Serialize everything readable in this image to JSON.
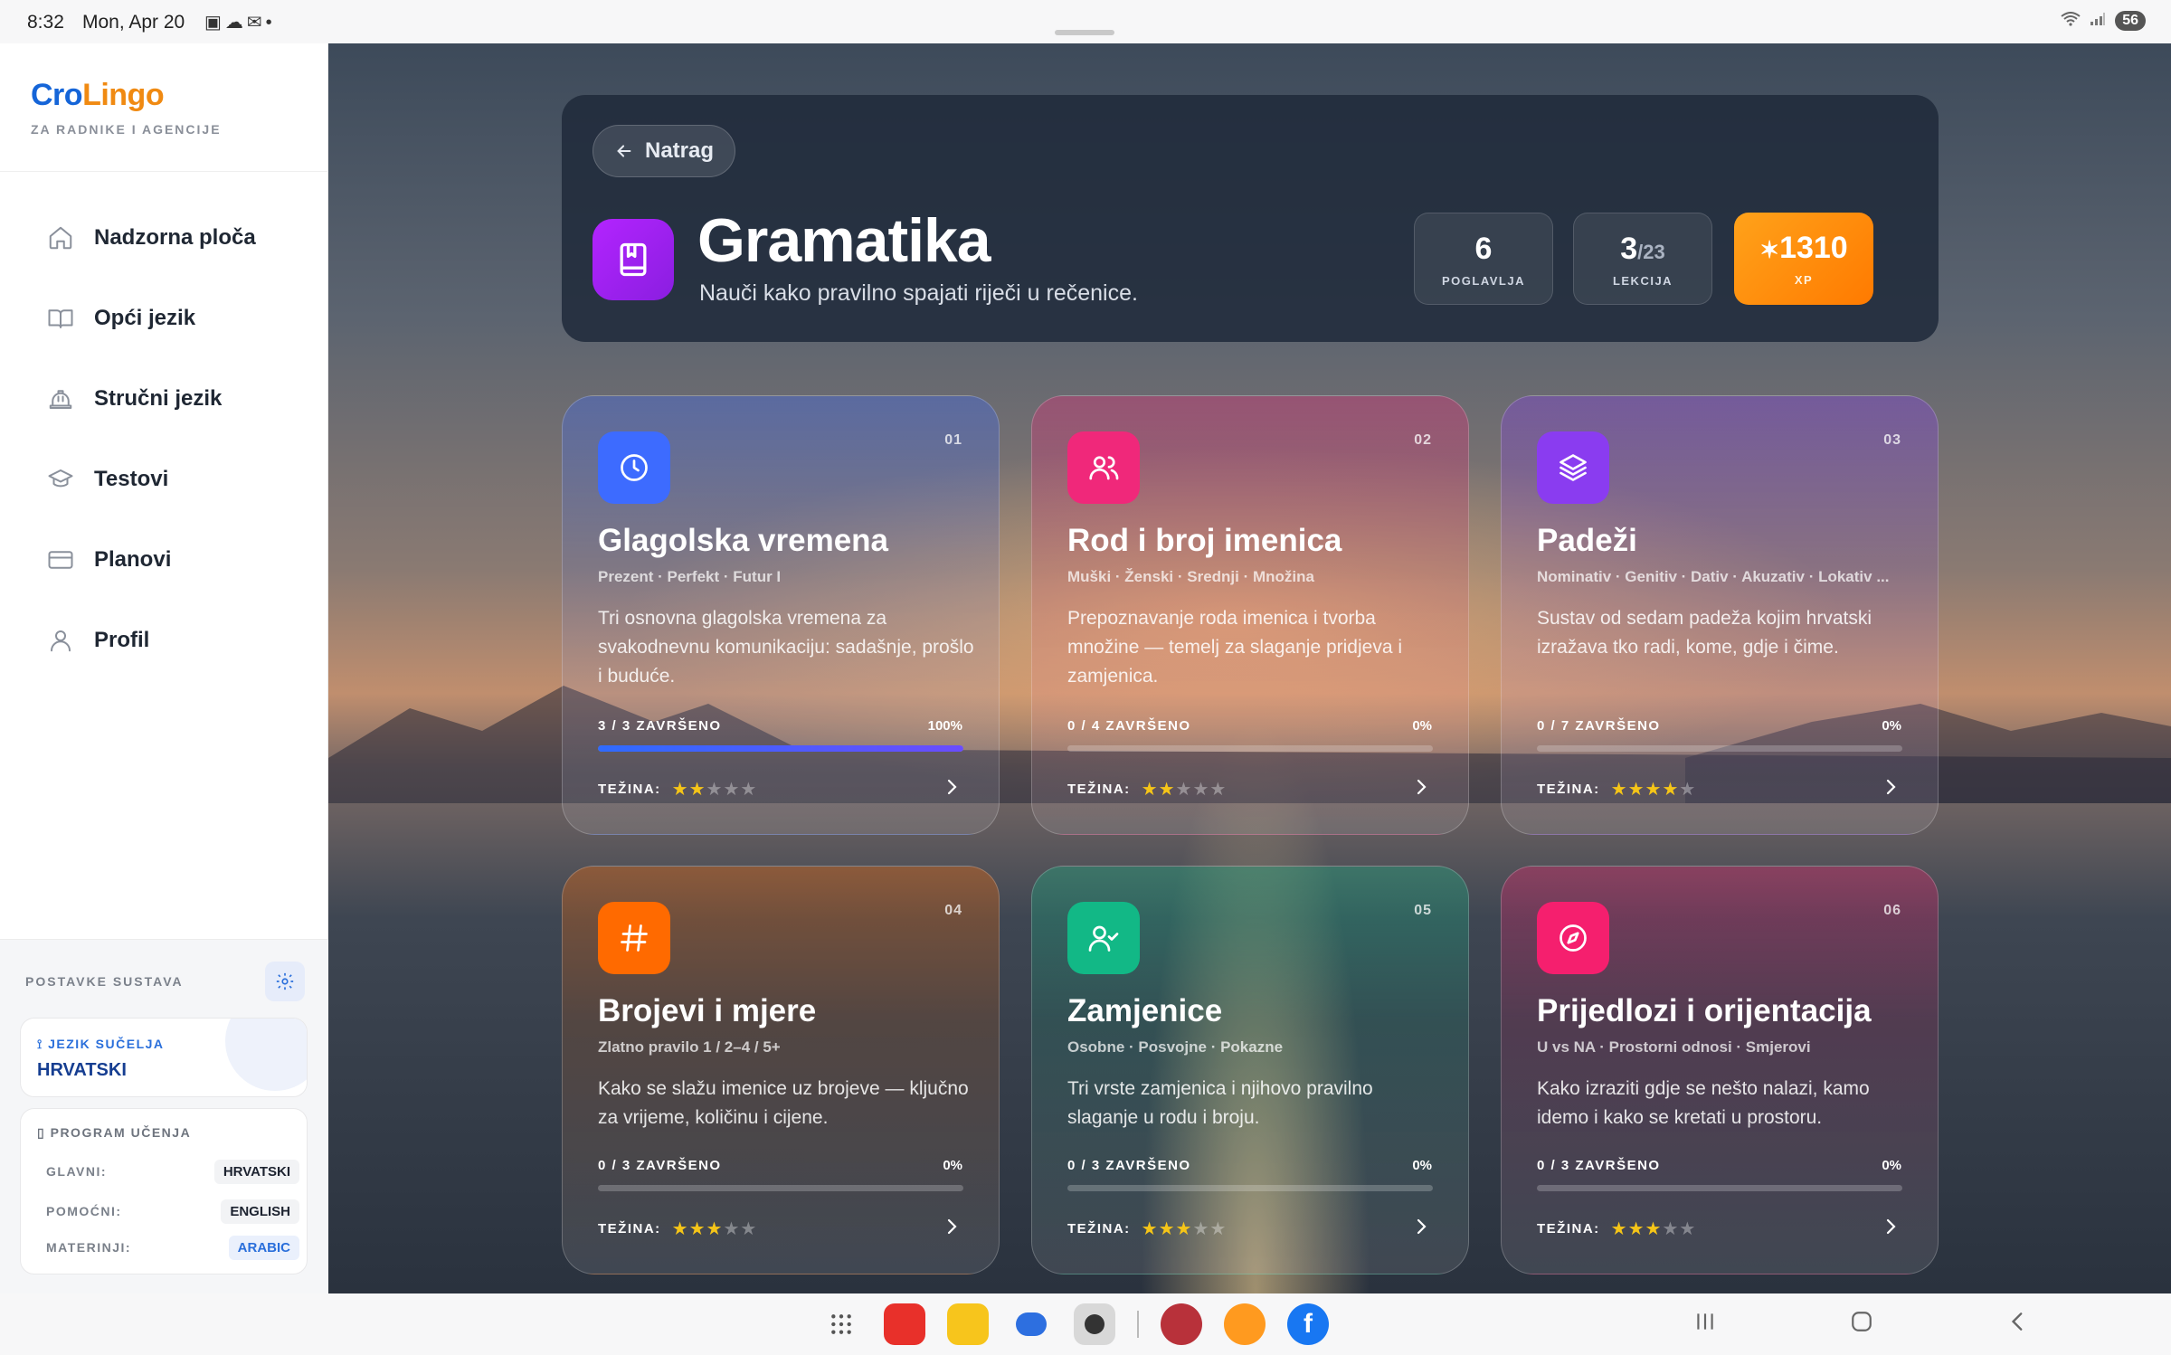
{
  "status_bar": {
    "time": "8:32",
    "date": "Mon, Apr 20",
    "battery": "56"
  },
  "sidebar": {
    "logo_part1": "Cro",
    "logo_part2": "Lingo",
    "logo_subtitle": "ZA RADNIKE I AGENCIJE",
    "nav": [
      {
        "label": "Nadzorna ploča",
        "icon": "home-icon"
      },
      {
        "label": "Opći jezik",
        "icon": "book-icon"
      },
      {
        "label": "Stručni jezik",
        "icon": "helmet-icon"
      },
      {
        "label": "Testovi",
        "icon": "graduation-cap-icon"
      },
      {
        "label": "Planovi",
        "icon": "credit-card-icon"
      },
      {
        "label": "Profil",
        "icon": "user-icon"
      }
    ],
    "settings_title": "POSTAVKE SUSTAVA",
    "interface_language_label": "JEZIK SUČELJA",
    "interface_language_value": "HRVATSKI",
    "program_label": "PROGRAM UČENJA",
    "program_rows": [
      {
        "key": "GLAVNI:",
        "value": "HRVATSKI"
      },
      {
        "key": "POMOĆNI:",
        "value": "ENGLISH"
      },
      {
        "key": "MATERINJI:",
        "value": "ARABIC"
      }
    ]
  },
  "header": {
    "back_label": "Natrag",
    "title": "Gramatika",
    "subtitle": "Nauči kako pravilno spajati riječi u rečenice.",
    "stats": {
      "chapters_value": "6",
      "chapters_label": "POGLAVLJA",
      "lessons_done": "3",
      "lessons_total": "/23",
      "lessons_label": "LEKCIJA",
      "xp_value": "1310",
      "xp_label": "XP"
    }
  },
  "difficulty_label": "TEŽINA:",
  "chapters": [
    {
      "num": "01",
      "title": "Glagolska vremena",
      "tags": "Prezent · Perfekt · Futur I",
      "desc": "Tri osnovna glagolska vremena za svakodnevnu komunikaciju: sadašnje, prošlo i buduće.",
      "progress_label": "3 / 3 ZAVRŠENO",
      "percent": "100%",
      "progress": 1.0,
      "difficulty": 2,
      "color": "#3d6bff",
      "icon": "clock-icon"
    },
    {
      "num": "02",
      "title": "Rod i broj imenica",
      "tags": "Muški · Ženski · Srednji · Množina",
      "desc": "Prepoznavanje roda imenica i tvorba množine — temelj za slaganje pridjeva i zamjenica.",
      "progress_label": "0 / 4 ZAVRŠENO",
      "percent": "0%",
      "progress": 0,
      "difficulty": 2,
      "color": "#f0287a",
      "icon": "users-icon"
    },
    {
      "num": "03",
      "title": "Padeži",
      "tags": "Nominativ · Genitiv · Dativ · Akuzativ · Lokativ ...",
      "desc": "Sustav od sedam padeža kojim hrvatski izražava tko radi, kome, gdje i čime.",
      "progress_label": "0 / 7 ZAVRŠENO",
      "percent": "0%",
      "progress": 0,
      "difficulty": 4,
      "color": "#8a3cf0",
      "icon": "layers-icon"
    },
    {
      "num": "04",
      "title": "Brojevi i mjere",
      "tags": "Zlatno pravilo 1 / 2–4 / 5+",
      "desc": "Kako se slažu imenice uz brojeve — ključno za vrijeme, količinu i cijene.",
      "progress_label": "0 / 3 ZAVRŠENO",
      "percent": "0%",
      "progress": 0,
      "difficulty": 3,
      "color": "#ff6a00",
      "icon": "hash-icon"
    },
    {
      "num": "05",
      "title": "Zamjenice",
      "tags": "Osobne · Posvojne · Pokazne",
      "desc": "Tri vrste zamjenica i njihovo pravilno slaganje u rodu i broju.",
      "progress_label": "0 / 3 ZAVRŠENO",
      "percent": "0%",
      "progress": 0,
      "difficulty": 3,
      "color": "#12b886",
      "icon": "user-check-icon"
    },
    {
      "num": "06",
      "title": "Prijedlozi i orijentacija",
      "tags": "U vs NA · Prostorni odnosi · Smjerovi",
      "desc": "Kako izraziti gdje se nešto nalazi, kamo idemo i kako se kretati u prostoru.",
      "progress_label": "0 / 3 ZAVRŠENO",
      "percent": "0%",
      "progress": 0,
      "difficulty": 3,
      "color": "#f51f6e",
      "icon": "compass-icon"
    }
  ]
}
